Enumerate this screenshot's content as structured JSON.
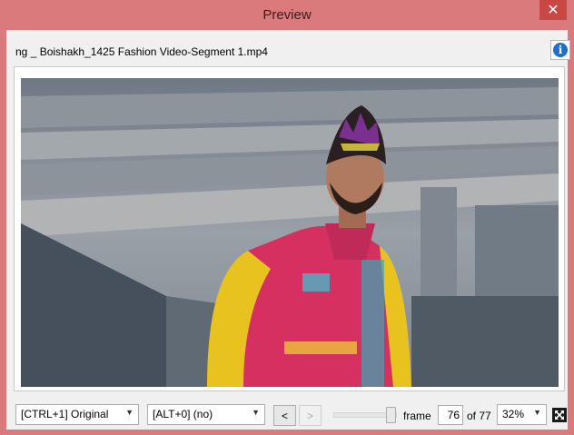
{
  "window": {
    "title": "Preview",
    "close_glyph": "✕"
  },
  "header": {
    "filename": "ng _ Boishakh_1425 Fashion Video-Segment 1.mp4",
    "info_icon": "info-icon"
  },
  "video": {
    "description_icon": "video-frame-image"
  },
  "toolbar": {
    "view_mode": "[CTRL+1] Original",
    "alt_mode": "[ALT+0] (no)",
    "prev_label": "<",
    "next_label": ">",
    "frame_label": "frame",
    "frame_value": "76",
    "of_label": "of 77",
    "zoom_value": "32%",
    "slider_position": 0.99
  },
  "colors": {
    "titlebar": "#db7a7d",
    "close": "#c94744",
    "info_blue": "#1e6fd0"
  }
}
